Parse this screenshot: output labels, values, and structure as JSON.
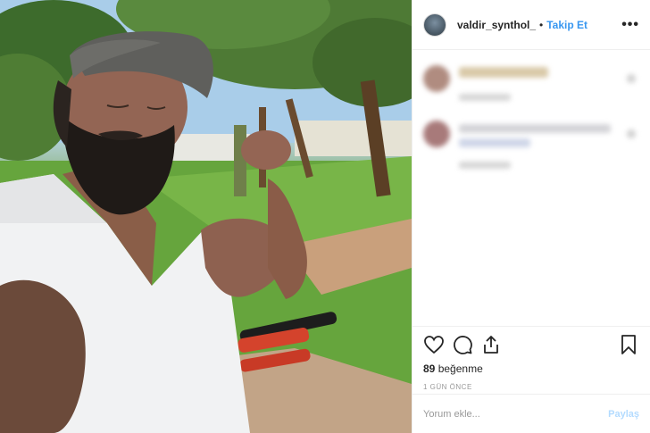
{
  "post": {
    "username": "valdir_synthol_",
    "separator": "•",
    "follow_label": "Takip Et",
    "more_label": "•••",
    "likes_count": "89",
    "likes_label": "beğenme",
    "time_ago": "1 GÜN ÖNCE",
    "comment_placeholder": "Yorum ekle...",
    "share_label": "Paylaş"
  },
  "icons": {
    "like": "heart-icon",
    "comment": "comment-icon",
    "share": "share-icon",
    "save": "bookmark-icon",
    "more": "more-options-icon"
  },
  "colors": {
    "link_blue": "#3897f0",
    "disabled_blue": "#b3dbff",
    "border": "#efefef",
    "muted": "#999999",
    "text": "#262626"
  }
}
